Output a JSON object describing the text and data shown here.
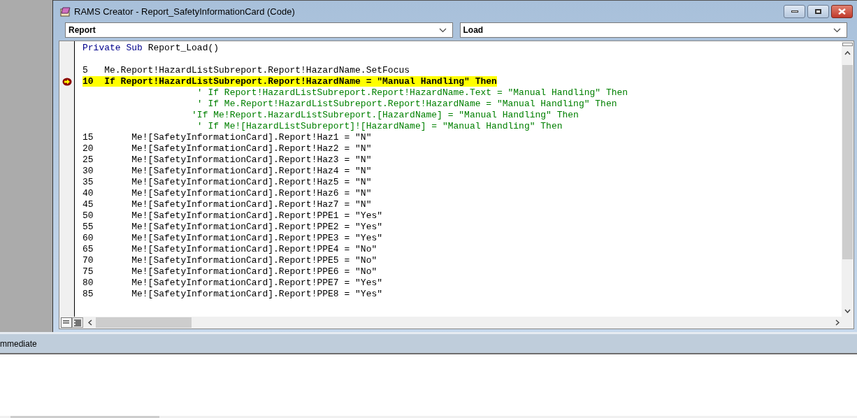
{
  "window": {
    "title": "RAMS Creator - Report_SafetyInformationCard (Code)"
  },
  "object_dropdown": {
    "value": "Report"
  },
  "procedure_dropdown": {
    "value": "Load"
  },
  "code_lines": [
    {
      "kind": "declaration",
      "keyword": "Private Sub",
      "text": " Report_Load()"
    },
    {
      "kind": "blank"
    },
    {
      "kind": "code",
      "text": "5   Me.Report!HazardListSubreport.Report!HazardName.SetFocus"
    },
    {
      "kind": "current",
      "text": "10  If Report!HazardListSubreport.Report!HazardName = \"Manual Handling\" Then"
    },
    {
      "kind": "comment",
      "text": "                     ' If Report!HazardListSubreport.Report!HazardName.Text = \"Manual Handling\" Then"
    },
    {
      "kind": "comment",
      "text": "                     ' If Me.Report!HazardListSubreport.Report!HazardName = \"Manual Handling\" Then"
    },
    {
      "kind": "comment",
      "text": "                    'If Me!Report.HazardListSubreport.[HazardName] = \"Manual Handling\" Then"
    },
    {
      "kind": "comment",
      "text": "                     ' If Me![HazardListSubreport]![HazardName] = \"Manual Handling\" Then"
    },
    {
      "kind": "code",
      "text": "15       Me![SafetyInformationCard].Report!Haz1 = \"N\""
    },
    {
      "kind": "code",
      "text": "20       Me![SafetyInformationCard].Report!Haz2 = \"N\""
    },
    {
      "kind": "code",
      "text": "25       Me![SafetyInformationCard].Report!Haz3 = \"N\""
    },
    {
      "kind": "code",
      "text": "30       Me![SafetyInformationCard].Report!Haz4 = \"N\""
    },
    {
      "kind": "code",
      "text": "35       Me![SafetyInformationCard].Report!Haz5 = \"N\""
    },
    {
      "kind": "code",
      "text": "40       Me![SafetyInformationCard].Report!Haz6 = \"N\""
    },
    {
      "kind": "code",
      "text": "45       Me![SafetyInformationCard].Report!Haz7 = \"N\""
    },
    {
      "kind": "code",
      "text": "50       Me![SafetyInformationCard].Report!PPE1 = \"Yes\""
    },
    {
      "kind": "code",
      "text": "55       Me![SafetyInformationCard].Report!PPE2 = \"Yes\""
    },
    {
      "kind": "code",
      "text": "60       Me![SafetyInformationCard].Report!PPE3 = \"Yes\""
    },
    {
      "kind": "code",
      "text": "65       Me![SafetyInformationCard].Report!PPE4 = \"No\""
    },
    {
      "kind": "code",
      "text": "70       Me![SafetyInformationCard].Report!PPE5 = \"No\""
    },
    {
      "kind": "code",
      "text": "75       Me![SafetyInformationCard].Report!PPE6 = \"No\""
    },
    {
      "kind": "code",
      "text": "80       Me![SafetyInformationCard].Report!PPE7 = \"Yes\""
    },
    {
      "kind": "code",
      "text": "85       Me![SafetyInformationCard].Report!PPE8 = \"Yes\""
    }
  ],
  "immediate": {
    "title": "mmediate"
  }
}
